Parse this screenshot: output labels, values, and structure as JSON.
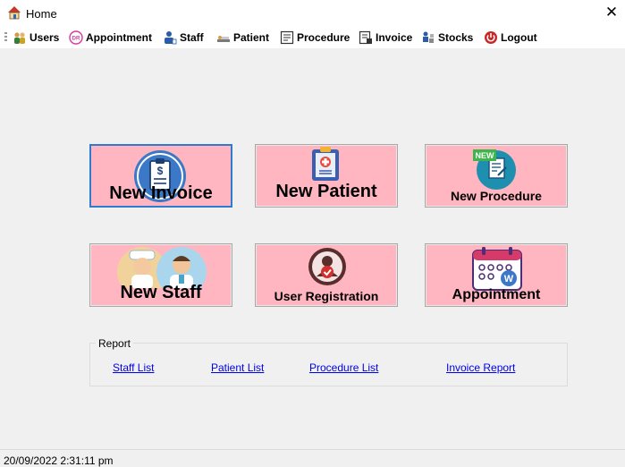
{
  "window": {
    "title": "Home",
    "close_glyph": "✕",
    "icon": "home-icon"
  },
  "menu": {
    "items": [
      {
        "label": "Users",
        "icon": "users-icon"
      },
      {
        "label": "Appointment",
        "icon": "appointment-icon"
      },
      {
        "label": "Staff",
        "icon": "staff-icon"
      },
      {
        "label": "Patient",
        "icon": "patient-icon"
      },
      {
        "label": "Procedure",
        "icon": "procedure-icon"
      },
      {
        "label": "Invoice",
        "icon": "invoice-icon"
      },
      {
        "label": "Stocks",
        "icon": "stocks-icon"
      },
      {
        "label": "Logout",
        "icon": "logout-icon"
      }
    ]
  },
  "tiles": {
    "new_invoice": {
      "label": "New Invoice",
      "icon": "invoice-clipboard-icon"
    },
    "new_patient": {
      "label": "New Patient",
      "icon": "patient-clipboard-icon"
    },
    "new_procedure": {
      "label": "New Procedure",
      "badge": "NEW",
      "icon": "procedure-document-icon"
    },
    "new_staff": {
      "label": "New Staff",
      "icon": "medical-staff-icon"
    },
    "user_registration": {
      "label": "User Registration",
      "icon": "user-check-icon"
    },
    "appointment": {
      "label": "Appointment",
      "icon": "calendar-icon"
    }
  },
  "report": {
    "legend": "Report",
    "links": [
      "Staff List",
      "Patient List",
      "Procedure List",
      "Invoice Report"
    ]
  },
  "status": {
    "datetime": "20/09/2022 2:31:11 pm"
  },
  "colors": {
    "tile_bg": "#ffb6c1",
    "focus_border": "#2e7bcf",
    "link": "#0000ee",
    "window_bg": "#f0f0f0"
  }
}
